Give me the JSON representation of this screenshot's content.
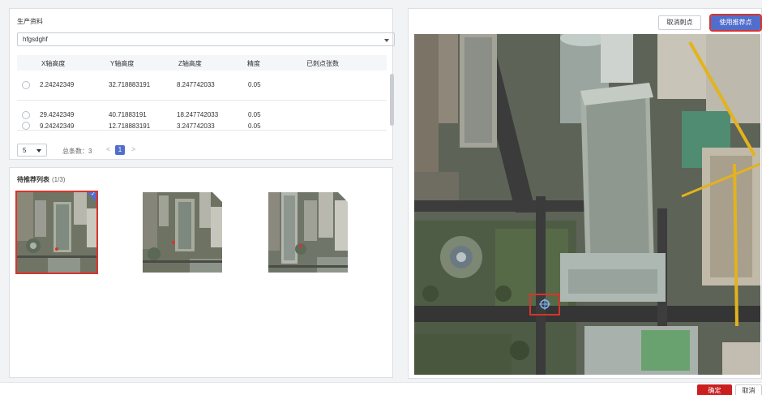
{
  "production": {
    "title": "生产资料",
    "selected": "hfgsdghf",
    "columns": [
      "X轴高度",
      "Y轴高度",
      "Z轴高度",
      "精度",
      "已刺点张数"
    ],
    "rows": [
      {
        "x": "2.24242349",
        "y": "32.718883191",
        "z": "8.247742033",
        "precision": "0.05",
        "count": ""
      },
      {
        "x": "29.4242349",
        "y": "40.71883191",
        "z": "18.247742033",
        "precision": "0.05",
        "count": ""
      },
      {
        "x": "9.24242349",
        "y": "12.718883191",
        "z": "3.247742033",
        "precision": "0.05",
        "count": ""
      }
    ],
    "pager": {
      "page_size": "5",
      "total": "总条数：3",
      "current": "1",
      "prev": "<",
      "next": ">"
    }
  },
  "recommend": {
    "title": "待推荐列表",
    "count": "(1/3)",
    "thumbs": [
      {
        "selected": true,
        "checked": true
      },
      {
        "selected": false,
        "checked": false
      },
      {
        "selected": false,
        "checked": false
      }
    ]
  },
  "image_panel": {
    "cancel_label": "取消刺点",
    "use_label": "使用推荐点"
  },
  "footer": {
    "ok_label": "确定",
    "cancel_label": "取消"
  },
  "colors": {
    "primary": "#526ecc",
    "danger": "#c9201f",
    "highlight": "#d9342b"
  }
}
